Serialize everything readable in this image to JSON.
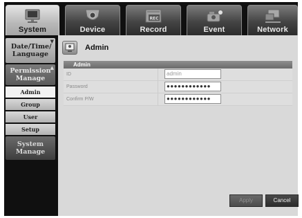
{
  "tabs": [
    {
      "label": "System",
      "icon": "monitor-icon",
      "active": true
    },
    {
      "label": "Device",
      "icon": "camera-icon",
      "active": false
    },
    {
      "label": "Record",
      "icon": "rec-icon",
      "active": false
    },
    {
      "label": "Event",
      "icon": "event-camera-icon",
      "active": false
    },
    {
      "label": "Network",
      "icon": "network-icon",
      "active": false
    }
  ],
  "sidebar": {
    "date_time_language": "Date/Time/ Language",
    "permission_manage": "Permission Manage",
    "sub_items": [
      "Admin",
      "Group",
      "User",
      "Setup"
    ],
    "system_manage": "System Manage"
  },
  "page": {
    "title": "Admin",
    "icon": "admin-icon"
  },
  "panel": {
    "header": "Admin",
    "rows": [
      {
        "label": "ID",
        "value": "admin"
      },
      {
        "label": "Password",
        "value": "●●●●●●●●●●●●"
      },
      {
        "label": "Confirm P/W",
        "value": "●●●●●●●●●●●●"
      }
    ]
  },
  "buttons": {
    "apply": "Apply",
    "cancel": "Cancel"
  },
  "colors": {
    "active_tab": "#c4c4c4",
    "inactive_tab": "#444444",
    "content_bg": "#d9d9d9",
    "panel_header": "#7a7a7a"
  }
}
